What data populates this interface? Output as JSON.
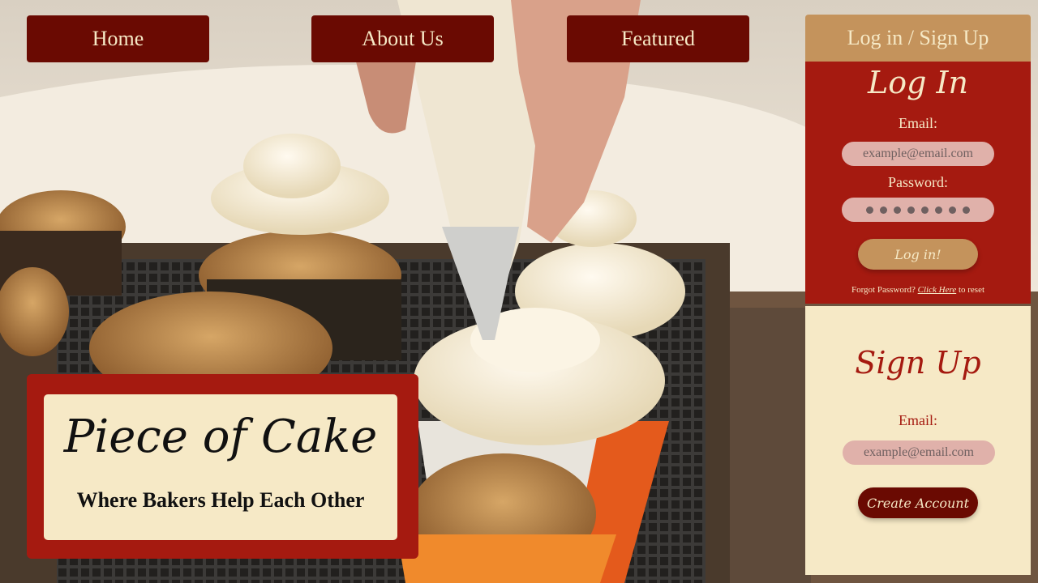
{
  "nav": {
    "home": "Home",
    "about": "About Us",
    "featured": "Featured",
    "auth_tab": "Log in / Sign Up"
  },
  "login": {
    "title": "Log In",
    "email_label": "Email:",
    "email_placeholder": "example@email.com",
    "password_label": "Password:",
    "password_dots": 8,
    "submit": "Log in!",
    "forgot_prefix": "Forgot Password?",
    "forgot_link": "Click Here",
    "forgot_suffix": "to reset"
  },
  "signup": {
    "title": "Sign Up",
    "email_label": "Email:",
    "email_placeholder": "example@email.com",
    "submit": "Create Account"
  },
  "brand": {
    "name": "Piece of Cake",
    "tagline": "Where Bakers Help Each Other"
  },
  "colors": {
    "dark_red": "#6a0a02",
    "red": "#a51a10",
    "tan": "#c4935c",
    "cream": "#f6e9c6",
    "input_pink": "#e0b1aa"
  },
  "background": {
    "subject": "hand piping cream frosting onto cupcakes on a cooling rack"
  }
}
